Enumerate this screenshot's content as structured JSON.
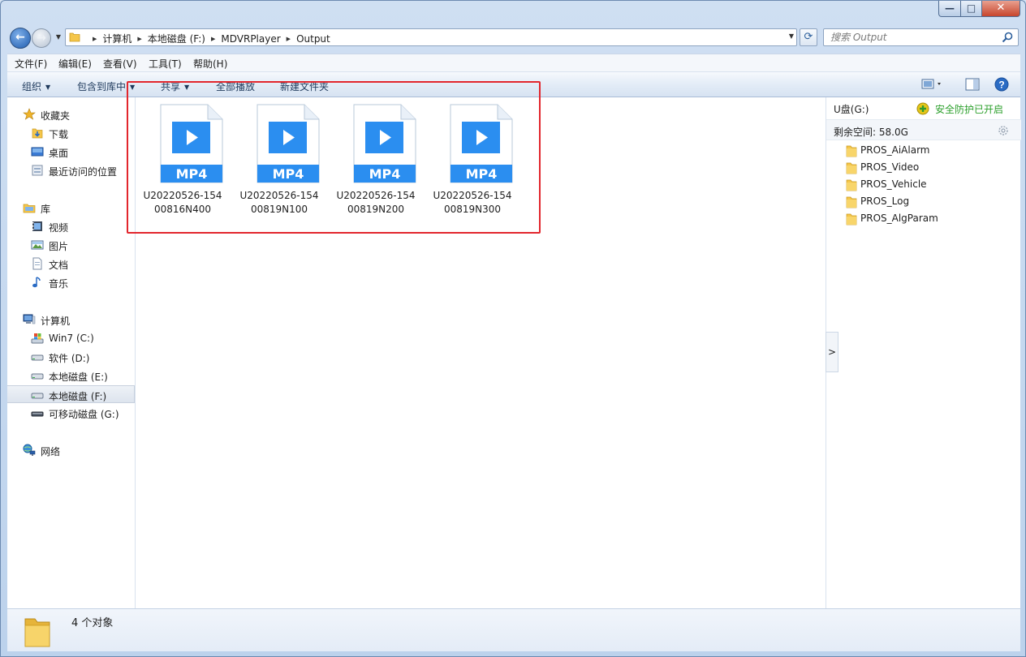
{
  "window": {
    "controls": {
      "minimize": "—",
      "maximize": "□",
      "close": "✕"
    }
  },
  "nav": {
    "back_icon": "←",
    "forward_icon": "→"
  },
  "address": {
    "breadcrumbs": [
      "计算机",
      "本地磁盘 (F:)",
      "MDVRPlayer",
      "Output"
    ],
    "refresh_icon": "⟳"
  },
  "search": {
    "placeholder": "搜索 Output"
  },
  "menubar": {
    "items": [
      "文件(F)",
      "编辑(E)",
      "查看(V)",
      "工具(T)",
      "帮助(H)"
    ]
  },
  "commandbar": {
    "organize": "组织",
    "include_in_library": "包含到库中",
    "share": "共享",
    "play_all": "全部播放",
    "new_folder": "新建文件夹"
  },
  "navpane": {
    "favorites": {
      "label": "收藏夹",
      "items": [
        "下载",
        "桌面",
        "最近访问的位置"
      ]
    },
    "libraries": {
      "label": "库",
      "items": [
        "视频",
        "图片",
        "文档",
        "音乐"
      ]
    },
    "computer": {
      "label": "计算机",
      "items": [
        "Win7 (C:)",
        "软件 (D:)",
        "本地磁盘 (E:)",
        "本地磁盘 (F:)",
        "可移动磁盘 (G:)"
      ],
      "selected": "本地磁盘 (F:)"
    },
    "network": {
      "label": "网络"
    }
  },
  "files": [
    {
      "badge": "MP4",
      "name_line1": "U20220526-154",
      "name_line2": "00816N400"
    },
    {
      "badge": "MP4",
      "name_line1": "U20220526-154",
      "name_line2": "00819N100"
    },
    {
      "badge": "MP4",
      "name_line1": "U20220526-154",
      "name_line2": "00819N200"
    },
    {
      "badge": "MP4",
      "name_line1": "U20220526-154",
      "name_line2": "00819N300"
    }
  ],
  "infopane": {
    "drive_title": "U盘(G:)",
    "protection_status": "安全防护已开启",
    "free_space": "剩余空间: 58.0G",
    "folders": [
      "PROS_AiAlarm",
      "PROS_Video",
      "PROS_Vehicle",
      "PROS_Log",
      "PROS_AlgParam"
    ],
    "toggle_icon": ">"
  },
  "statusbar": {
    "item_count": "4 个对象"
  },
  "colors": {
    "accent_blue": "#2b8ef0",
    "highlight_red": "#e2262d",
    "protection_green": "#2ca02c",
    "folder_yellow": "#f5c64a"
  }
}
